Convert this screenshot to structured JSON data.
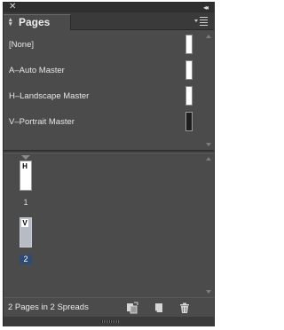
{
  "window": {
    "close_icon": "close-icon",
    "collapse_icon": "collapse-icon"
  },
  "tab": {
    "label": "Pages",
    "menu_icon": "panel-menu-icon"
  },
  "masters": [
    {
      "label": "[None]",
      "thumb": "white"
    },
    {
      "label": "A–Auto Master",
      "thumb": "white"
    },
    {
      "label": "H–Landscape Master",
      "thumb": "white"
    },
    {
      "label": "V–Portrait Master",
      "thumb": "dark"
    }
  ],
  "pages": [
    {
      "prefix": "H",
      "number": "1",
      "selected": false
    },
    {
      "prefix": "V",
      "number": "2",
      "selected": true
    }
  ],
  "footer": {
    "status": "2 Pages in 2 Spreads",
    "icons": [
      "edit-page-size-icon",
      "new-page-icon",
      "trash-icon"
    ]
  },
  "colors": {
    "panel_bg": "#4b4b4b",
    "selection": "#2f4a73"
  }
}
